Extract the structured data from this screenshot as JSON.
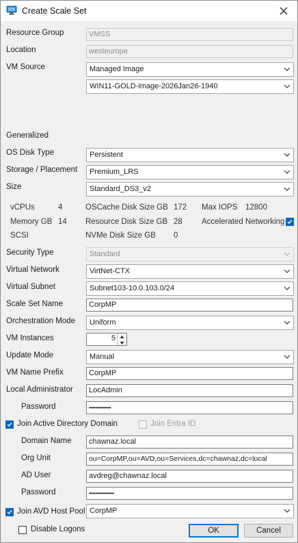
{
  "window": {
    "title": "Create Scale Set"
  },
  "labels": {
    "resource_group": "Resource Group",
    "location": "Location",
    "vm_source": "VM Source",
    "generalized": "Generalized",
    "os_disk_type": "OS Disk Type",
    "storage_placement": "Storage / Placement",
    "size": "Size",
    "security_type": "Security Type",
    "virtual_network": "Virtual Network",
    "virtual_subnet": "Virtual Subnet",
    "scale_set_name": "Scale Set  Name",
    "orchestration_mode": "Orchestration Mode",
    "vm_instances": "VM Instances",
    "update_mode": "Update Mode",
    "vm_name_prefix": "VM Name Prefix",
    "local_administrator": "Local Administrator",
    "password": "Password",
    "join_ad_domain": "Join Active Directory Domain",
    "join_entra_id": "Join Entra ID",
    "domain_name": "Domain Name",
    "org_unit": "Org Unit",
    "ad_user": "AD User",
    "ad_password": "Password",
    "join_avd_host_pool": "Join AVD Host Pool",
    "disable_logons": "Disable Logons"
  },
  "values": {
    "resource_group": "VMSS",
    "location": "westeurope",
    "vm_source": "Managed Image",
    "image": "WIN11-GOLD-image-2026Jan26-1940",
    "os_disk_type": "Persistent",
    "storage_placement": "Premium_LRS",
    "size": "Standard_DS3_v2",
    "security_type": "Standard",
    "virtual_network": "VirtNet-CTX",
    "virtual_subnet": "Subnet103-10.0.103.0/24",
    "scale_set_name": "CorpMP",
    "orchestration_mode": "Uniform",
    "vm_instances": "5",
    "update_mode": "Manual",
    "vm_name_prefix": "CorpMP",
    "local_administrator": "LocAdmin",
    "password": "••••••••••••••",
    "domain_name": "chawnaz.local",
    "org_unit": "ou=CorpMP,ou=AVD,ou=Services,dc=chawnaz,dc=local",
    "ad_user": "avdreg@chawnaz.local",
    "ad_password": "••••••••••••••••",
    "host_pool": "CorpMP"
  },
  "size_info": {
    "vcpus_label": "vCPUs",
    "vcpus": "4",
    "memory_label": "Memory GB",
    "memory": "14",
    "scsi_label": "SCSI",
    "os_cache_label": "OSCache Disk Size GB",
    "os_cache": "172",
    "resource_disk_label": "Resource Disk Size GB",
    "resource_disk": "28",
    "nvme_label": "NVMe Disk Size GB",
    "nvme": "0",
    "max_iops_label": "Max IOPS",
    "max_iops": "12800",
    "accel_net_label": "Accelerated Networking"
  },
  "checkboxes": {
    "accelerated_networking": true,
    "join_ad_domain": true,
    "join_entra_id": false,
    "join_avd_host_pool": true,
    "disable_logons": false
  },
  "buttons": {
    "ok": "OK",
    "cancel": "Cancel"
  },
  "colors": {
    "accent": "#0067c0",
    "window_bg": "#f0f0f0"
  }
}
